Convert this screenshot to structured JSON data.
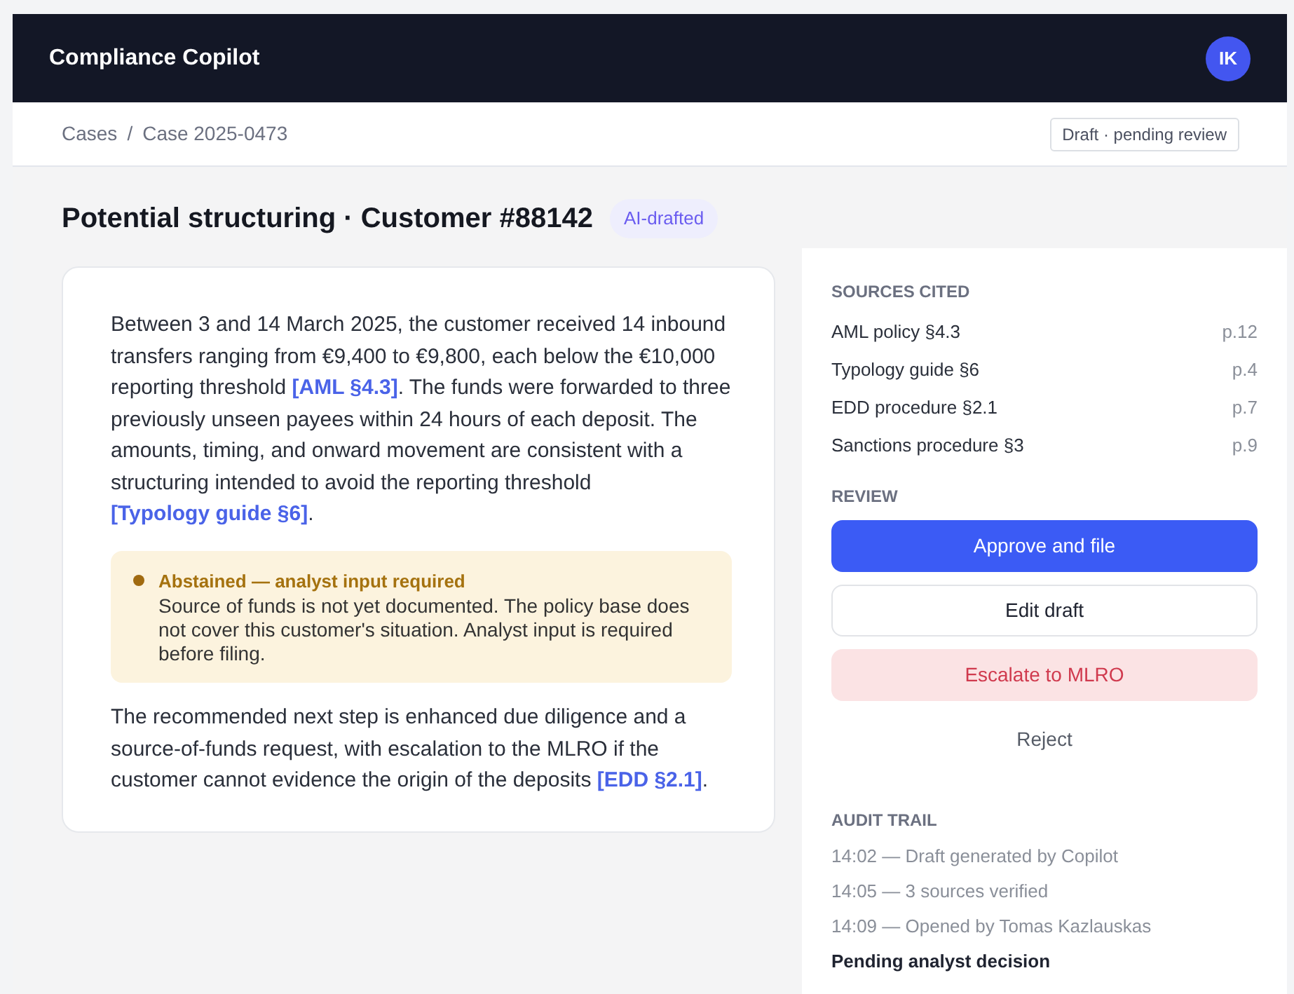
{
  "app": {
    "title": "Compliance Copilot",
    "avatar": "IK"
  },
  "breadcrumb": [
    "Cases",
    "Case 2025-0473"
  ],
  "breadcrumb_separator": "/",
  "status_badge": "Draft · pending review",
  "case": {
    "title": "Potential structuring · Customer #88142",
    "badge": "AI-drafted"
  },
  "draft": {
    "paragraphs": [
      [
        {
          "kind": "text",
          "text": "Between 3 and 14 March 2025, the customer received 14 inbound transfers ranging from €9,400 to €9,800, each below the €10,000 reporting threshold "
        },
        {
          "kind": "citation",
          "text": "[AML §4.3]"
        },
        {
          "kind": "text",
          "text": ". The funds were forwarded to three previously unseen payees within 24 hours of each deposit. The amounts, timing, and onward movement are consistent with a structuring intended to avoid the reporting threshold "
        },
        {
          "kind": "citation",
          "text": "[Typology guide §6]"
        },
        {
          "kind": "text",
          "text": "."
        }
      ],
      [
        {
          "kind": "text",
          "text": "The recommended next step is enhanced due diligence and a source-of-funds request, with escalation to the MLRO if the customer cannot evidence the origin of the deposits "
        },
        {
          "kind": "citation",
          "text": "[EDD §2.1]"
        },
        {
          "kind": "text",
          "text": "."
        }
      ]
    ],
    "notice": {
      "title": "Abstained — analyst input required",
      "body": "Source of funds is not yet documented. The policy base does not cover this customer's situation. Analyst input is required before filing."
    }
  },
  "sources": {
    "heading": "SOURCES CITED",
    "items": [
      {
        "name": "AML policy §4.3",
        "page": "p.12"
      },
      {
        "name": "Typology guide §6",
        "page": "p.4"
      },
      {
        "name": "EDD procedure §2.1",
        "page": "p.7"
      },
      {
        "name": "Sanctions procedure §3",
        "page": "p.9"
      }
    ]
  },
  "review": {
    "heading": "REVIEW",
    "buttons": [
      {
        "kind": "primary",
        "label": "Approve and file"
      },
      {
        "kind": "secondary",
        "label": "Edit draft"
      },
      {
        "kind": "danger",
        "label": "Escalate to MLRO"
      },
      {
        "kind": "ghost",
        "label": "Reject"
      }
    ]
  },
  "audit": {
    "heading": "AUDIT TRAIL",
    "entries": [
      "14:02 — Draft generated by Copilot",
      "14:05 — 3 sources verified",
      "14:09 — Opened by Tomas Kazlauskas"
    ],
    "status": "Pending analyst decision"
  }
}
